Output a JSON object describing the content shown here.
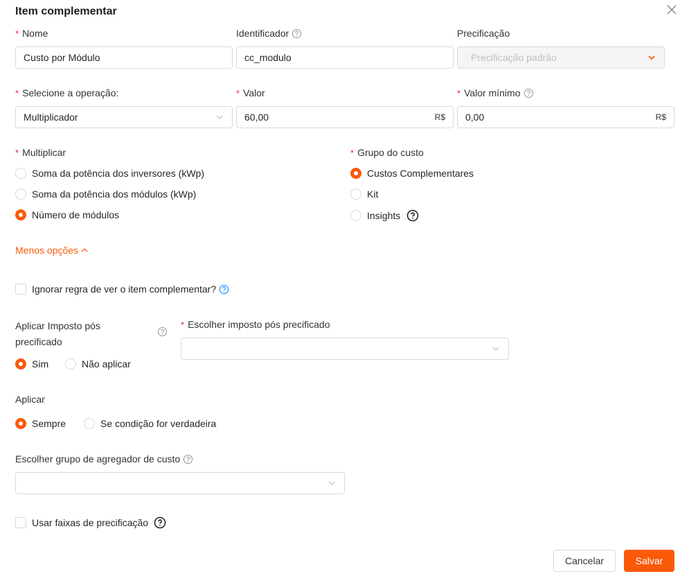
{
  "modal": {
    "title": "Item complementar"
  },
  "fields": {
    "nome": {
      "label": "Nome",
      "value": "Custo por Módulo"
    },
    "identificador": {
      "label": "Identificador",
      "value": "cc_modulo"
    },
    "precificacao": {
      "label": "Precificação",
      "placeholder": "Precificação padrão"
    },
    "operacao": {
      "label": "Selecione a operação:",
      "value": "Multiplicador"
    },
    "valor": {
      "label": "Valor",
      "value": "60,00",
      "suffix": "R$"
    },
    "valor_minimo": {
      "label": "Valor mínimo",
      "value": "0,00",
      "suffix": "R$"
    }
  },
  "multiplicar": {
    "label": "Multiplicar",
    "options": [
      {
        "label": "Soma da potência dos inversores (kWp)",
        "selected": false
      },
      {
        "label": "Soma da potência dos módulos (kWp)",
        "selected": false
      },
      {
        "label": "Número de módulos",
        "selected": true
      }
    ]
  },
  "grupo_custo": {
    "label": "Grupo do custo",
    "options": [
      {
        "label": "Custos Complementares",
        "selected": true
      },
      {
        "label": "Kit",
        "selected": false
      },
      {
        "label": "Insights",
        "selected": false
      }
    ]
  },
  "menos_opcoes": "Menos opções",
  "ignorar_regra": {
    "label": "Ignorar regra de ver o item complementar?",
    "checked": false
  },
  "imposto": {
    "label_line1": "Aplicar Imposto pós",
    "label_line2": "precificado",
    "options": [
      {
        "label": "Sim",
        "selected": true
      },
      {
        "label": "Não aplicar",
        "selected": false
      }
    ],
    "escolher_label": "Escolher imposto pós precificado",
    "escolher_value": ""
  },
  "aplicar": {
    "label": "Aplicar",
    "options": [
      {
        "label": "Sempre",
        "selected": true
      },
      {
        "label": "Se condição for verdadeira",
        "selected": false
      }
    ]
  },
  "agregador": {
    "label": "Escolher grupo de agregador de custo",
    "value": ""
  },
  "faixas": {
    "label": "Usar faixas de precificação",
    "checked": false
  },
  "footer": {
    "cancel": "Cancelar",
    "save": "Salvar"
  },
  "colors": {
    "accent": "#fa5a0a",
    "required": "#f5222d",
    "info_blue": "#1890ff"
  }
}
